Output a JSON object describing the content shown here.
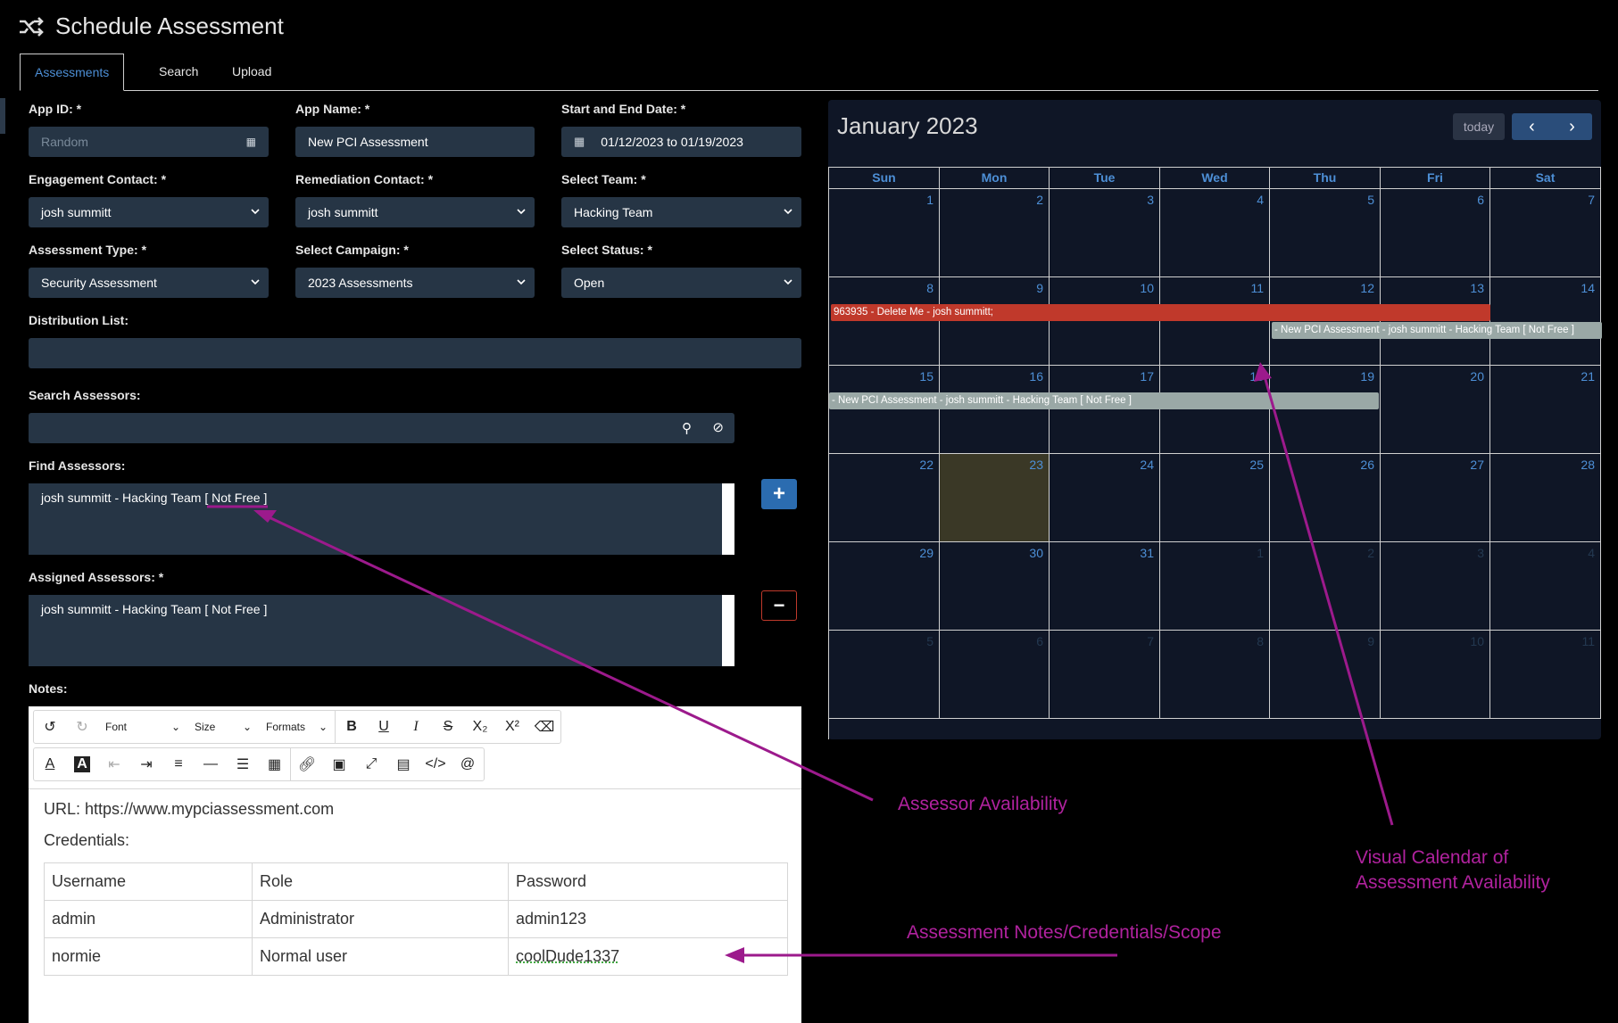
{
  "header": {
    "title": "Schedule Assessment",
    "icon": "shuffle-icon"
  },
  "tabs": [
    "Assessments",
    "Search",
    "Upload"
  ],
  "form": {
    "app_id": {
      "label": "App ID: *",
      "placeholder": "Random"
    },
    "app_name": {
      "label": "App Name: *",
      "value": "New PCI Assessment"
    },
    "dates": {
      "label": "Start and End Date: *",
      "value": "01/12/2023 to 01/19/2023"
    },
    "engagement_contact": {
      "label": "Engagement Contact: *",
      "value": "josh summitt"
    },
    "remediation_contact": {
      "label": "Remediation Contact: *",
      "value": "josh summitt"
    },
    "team": {
      "label": "Select Team: *",
      "value": "Hacking Team"
    },
    "assessment_type": {
      "label": "Assessment Type: *",
      "value": "Security Assessment"
    },
    "campaign": {
      "label": "Select Campaign: *",
      "value": "2023 Assessments"
    },
    "status": {
      "label": "Select Status: *",
      "value": "Open"
    },
    "distribution": {
      "label": "Distribution List:",
      "value": ""
    },
    "search_assessors": {
      "label": "Search Assessors:",
      "value": ""
    },
    "find_assessors": {
      "label": "Find Assessors:",
      "value": "josh summitt - Hacking Team [ Not Free ]"
    },
    "assigned_assessors": {
      "label": "Assigned Assessors: *",
      "value": "josh summitt - Hacking Team [ Not Free ]"
    },
    "notes_label": "Notes:"
  },
  "editor": {
    "font": "Font",
    "size": "Size",
    "formats": "Formats",
    "url_line": "URL: https://www.mypciassessment.com",
    "cred_line": "Credentials:",
    "table": [
      [
        "Username",
        "Role",
        "Password"
      ],
      [
        "admin",
        "Administrator",
        "admin123"
      ],
      [
        "normie",
        "Normal user",
        "coolDude1337"
      ]
    ]
  },
  "calendar": {
    "title": "January 2023",
    "today_label": "today",
    "days": [
      "Sun",
      "Mon",
      "Tue",
      "Wed",
      "Thu",
      "Fri",
      "Sat"
    ],
    "weeks": [
      [
        "1",
        "2",
        "3",
        "4",
        "5",
        "6",
        "7"
      ],
      [
        "8",
        "9",
        "10",
        "11",
        "12",
        "13",
        "14"
      ],
      [
        "15",
        "16",
        "17",
        "18",
        "19",
        "20",
        "21"
      ],
      [
        "22",
        "23",
        "24",
        "25",
        "26",
        "27",
        "28"
      ],
      [
        "29",
        "30",
        "31",
        "1",
        "2",
        "3",
        "4"
      ],
      [
        "5",
        "6",
        "7",
        "8",
        "9",
        "10",
        "11"
      ]
    ],
    "events": [
      {
        "text": "963935 - Delete Me - josh summitt;",
        "color": "#c0392b"
      },
      {
        "text": "- New PCI Assessment - josh summitt - Hacking Team [ Not Free ]",
        "color": "#9aa8a6"
      },
      {
        "text": "- New PCI Assessment - josh summitt - Hacking Team [ Not Free ]",
        "color": "#9aa8a6"
      }
    ]
  },
  "annotations": {
    "assessor": "Assessor Availability",
    "calendar": "Visual Calendar of Assessment Availability",
    "notes": "Assessment Notes/Credentials/Scope",
    "color": "#b0229e"
  }
}
